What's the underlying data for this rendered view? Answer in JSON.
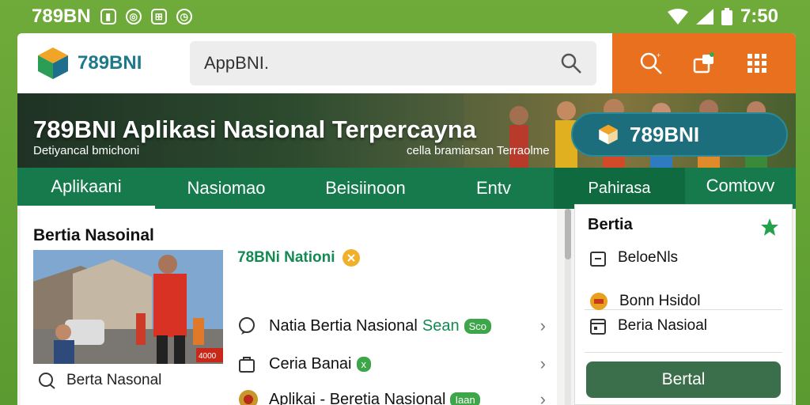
{
  "status_bar": {
    "carrier": "789BN",
    "time": "7:50"
  },
  "header": {
    "logo_text": "789BNI",
    "search_value": "AppBNI.",
    "icons": [
      "search-icon",
      "share-icon",
      "grid-icon"
    ]
  },
  "hero": {
    "title": "789BNI  Aplikasi Nasional Terpercayna",
    "subtitle_left": "Detiyancal bmichoni",
    "subtitle_right": "cella bramiarsan Terraolme",
    "button_label": "789BNI"
  },
  "tabs": [
    {
      "label": "Aplikaani"
    },
    {
      "label": "Nasiomao"
    },
    {
      "label": "Beisiinoon"
    },
    {
      "label": "Entv"
    },
    {
      "label": "Pahirasa"
    },
    {
      "label": "Comtovv"
    }
  ],
  "main": {
    "section_title": "Bertia Nasoinal",
    "thumb_badge": "4000",
    "thumb_caption": "Berta Nasonal",
    "featured_label": "78BNi Nationi",
    "rows": [
      {
        "label": "Natia Bertia Nasional",
        "tag": "Sean",
        "badge": "Sco",
        "icon": "chat-icon"
      },
      {
        "label": "Ceria Banai",
        "badge": "x",
        "icon": "bag-icon"
      },
      {
        "label": "Aplikai - Beretia Nasional",
        "badge": "Iaan",
        "icon": "emblem-icon"
      }
    ]
  },
  "side": {
    "title": "Bertia",
    "items": [
      {
        "label": "BeloeNls",
        "icon": "clipboard-icon"
      },
      {
        "label": "Bonn Hsidol",
        "icon": "coin-icon"
      },
      {
        "label": "Beria Nasioal",
        "icon": "calendar-icon"
      }
    ],
    "button_label": "Bertal"
  },
  "colors": {
    "brand_green": "#167a4d",
    "accent_orange": "#e8701e",
    "teal": "#1d6e7c"
  }
}
